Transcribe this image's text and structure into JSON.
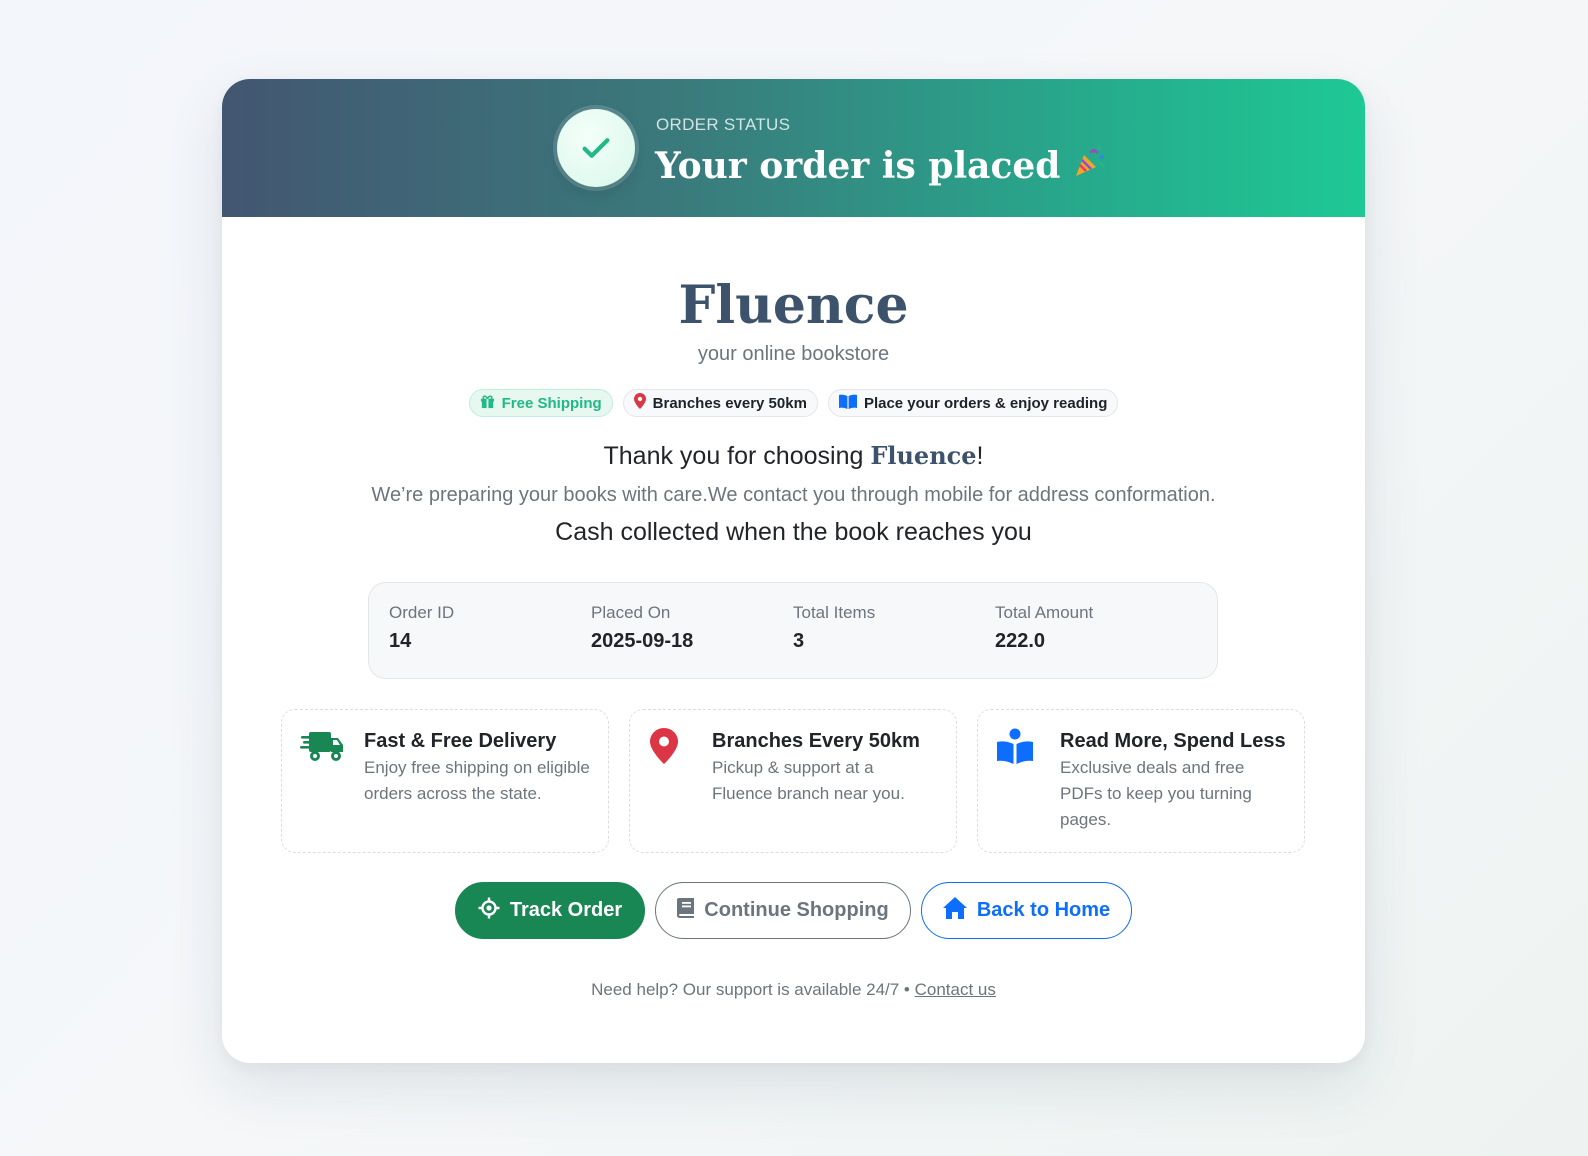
{
  "header": {
    "status_label": "ORDER STATUS",
    "title": "Your order is placed",
    "title_emoji": "🎉"
  },
  "brand": {
    "name": "Fluence",
    "tagline": "your online bookstore"
  },
  "chips": [
    {
      "label": "Free Shipping",
      "icon": "gift-icon"
    },
    {
      "label": "Branches every 50km",
      "icon": "map-pin-icon"
    },
    {
      "label": "Place your orders & enjoy reading",
      "icon": "book-icon"
    }
  ],
  "message": {
    "thank_prefix": "Thank you for choosing ",
    "thank_brand": "Fluence",
    "thank_suffix": "!",
    "preparing": "We’re preparing your books with care.We contact you through mobile for address conformation.",
    "cash": "Cash collected when the book reaches you"
  },
  "summary": {
    "order_id_label": "Order ID",
    "order_id": "14",
    "placed_on_label": "Placed On",
    "placed_on": "2025-09-18",
    "total_items_label": "Total Items",
    "total_items": "3",
    "total_amount_label": "Total Amount",
    "total_amount": "222.0"
  },
  "features": [
    {
      "title": "Fast & Free Delivery",
      "desc": "Enjoy free shipping on eligible orders across the state.",
      "icon": "truck-icon"
    },
    {
      "title": "Branches Every 50km",
      "desc": "Pickup & support at a Fluence branch near you.",
      "icon": "map-pin-icon"
    },
    {
      "title": "Read More, Spend Less",
      "desc": "Exclusive deals and free PDFs to keep you turning pages.",
      "icon": "reader-icon"
    }
  ],
  "buttons": {
    "track": "Track Order",
    "shop": "Continue Shopping",
    "home": "Back to Home"
  },
  "help": {
    "text": "Need help? Our support is available 24/7 • ",
    "link": "Contact us"
  },
  "colors": {
    "header_start": "#435671",
    "header_end": "#1ec995",
    "brand": "#3d526b",
    "success": "#198754",
    "primary": "#0d6efd",
    "danger": "#dc3545"
  }
}
